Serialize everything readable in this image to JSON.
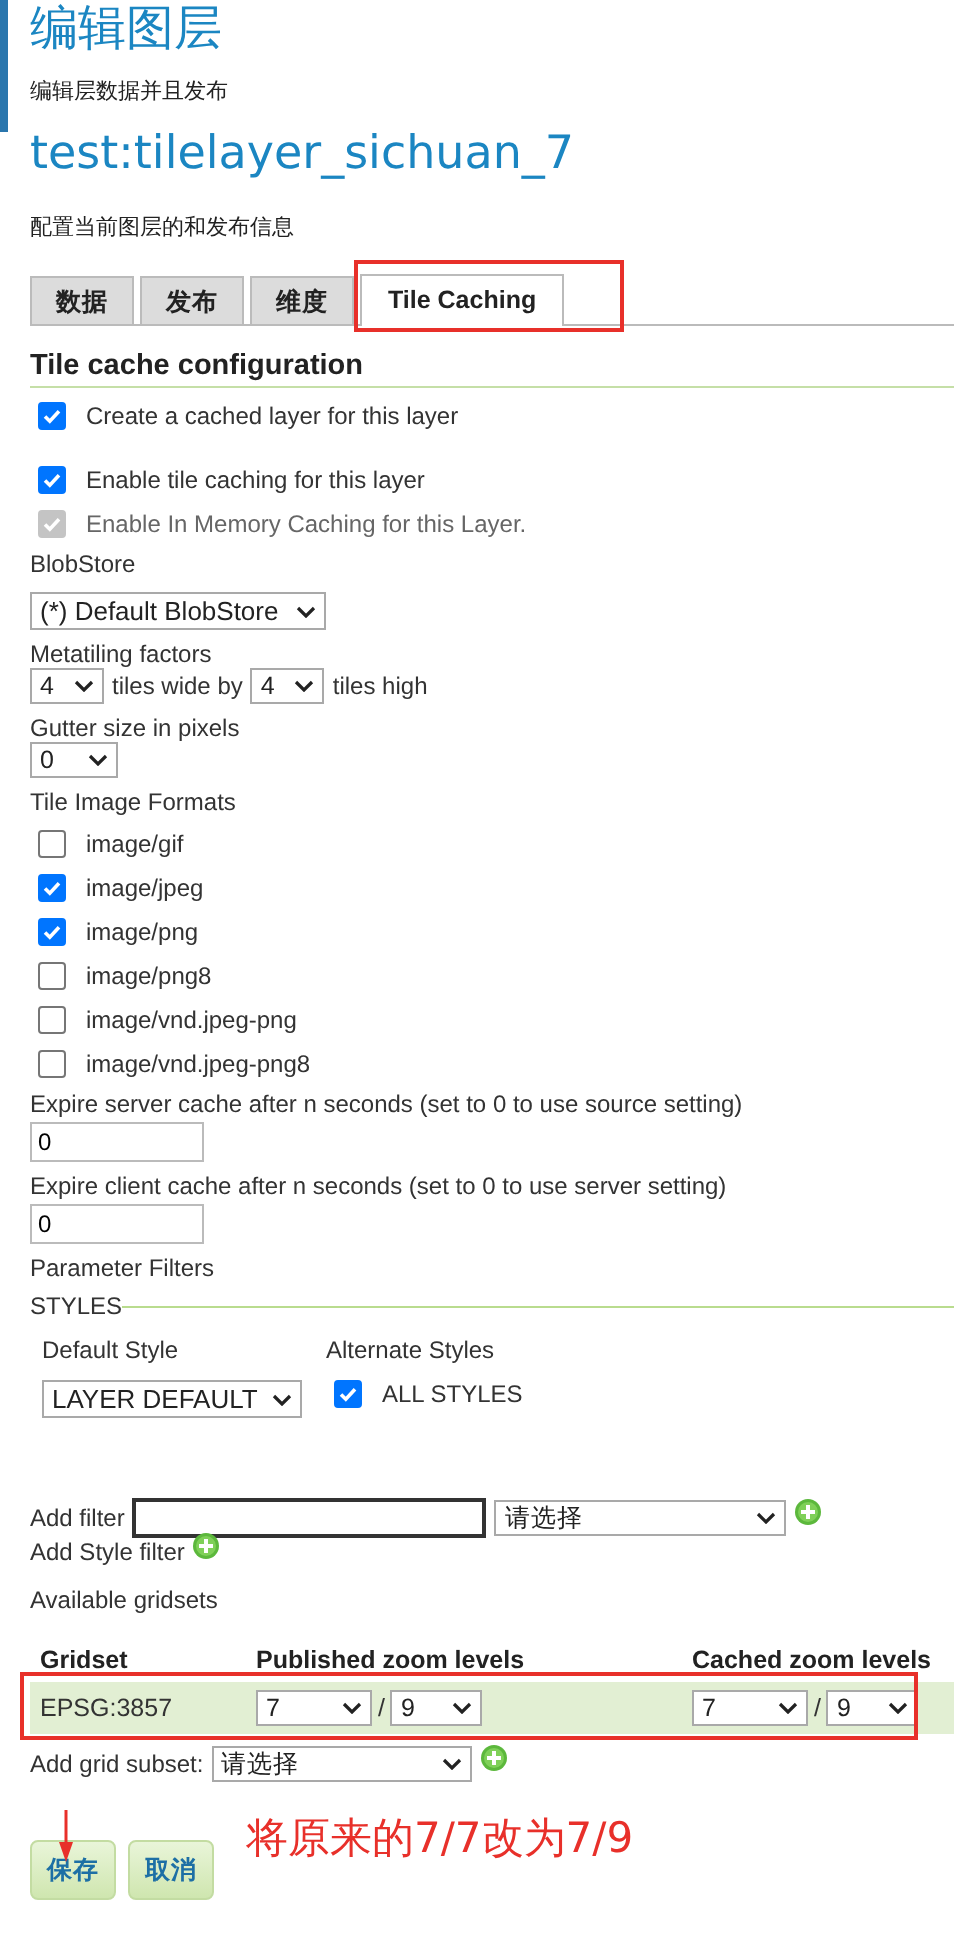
{
  "header": {
    "title": "编辑图层",
    "subtitle": "编辑层数据并且发布",
    "layer_name": "test:tilelayer_sichuan_7",
    "description": "配置当前图层的和发布信息"
  },
  "tabs": [
    {
      "label": "数据",
      "selected": false,
      "highlighted": false
    },
    {
      "label": "发布",
      "selected": false,
      "highlighted": false
    },
    {
      "label": "维度",
      "selected": false,
      "highlighted": false
    },
    {
      "label": "Tile Caching",
      "selected": true,
      "highlighted": true
    }
  ],
  "section_title": "Tile cache configuration",
  "options": [
    {
      "label": "Create a cached layer for this layer",
      "checked": true,
      "disabled": false
    },
    {
      "label": "Enable tile caching for this layer",
      "checked": true,
      "disabled": false
    },
    {
      "label": "Enable In Memory Caching for this Layer.",
      "checked": true,
      "disabled": true
    }
  ],
  "blobstore": {
    "label": "BlobStore",
    "value": "(*) Default BlobStore"
  },
  "metatiling": {
    "label": "Metatiling factors",
    "wide_value": "4",
    "wide_text": "tiles wide by",
    "high_value": "4",
    "high_text": "tiles high"
  },
  "gutter": {
    "label": "Gutter size in pixels",
    "value": "0"
  },
  "formats": {
    "label": "Tile Image Formats",
    "items": [
      {
        "label": "image/gif",
        "checked": false
      },
      {
        "label": "image/jpeg",
        "checked": true
      },
      {
        "label": "image/png",
        "checked": true
      },
      {
        "label": "image/png8",
        "checked": false
      },
      {
        "label": "image/vnd.jpeg-png",
        "checked": false
      },
      {
        "label": "image/vnd.jpeg-png8",
        "checked": false
      }
    ]
  },
  "server_expire": {
    "label": "Expire server cache after n seconds (set to 0 to use source setting)",
    "value": "0"
  },
  "client_expire": {
    "label": "Expire client cache after n seconds (set to 0 to use server setting)",
    "value": "0"
  },
  "parameter_filters_label": "Parameter Filters",
  "styles": {
    "legend": "STYLES",
    "default_label": "Default Style",
    "default_value": "LAYER DEFAULT",
    "alternate_label": "Alternate Styles",
    "all_styles": {
      "label": "ALL STYLES",
      "checked": true
    }
  },
  "add_filter": {
    "label": "Add filter",
    "select_value": "请选择"
  },
  "add_style_filter": {
    "label": "Add Style filter"
  },
  "gridsets": {
    "label": "Available gridsets",
    "columns": [
      "Gridset",
      "Published zoom levels",
      "Cached zoom levels"
    ],
    "rows": [
      {
        "name": "EPSG:3857",
        "highlighted": true,
        "published": {
          "min": "7",
          "separator": "/",
          "max": "9"
        },
        "cached": {
          "min": "7",
          "separator": "/",
          "max": "9"
        }
      }
    ]
  },
  "add_grid_subset": {
    "label": "Add grid subset:",
    "value": "请选择"
  },
  "annotation": "将原来的7/7改为7/9",
  "buttons": [
    {
      "label": "保存",
      "pointed": true
    },
    {
      "label": "取消",
      "pointed": false
    }
  ]
}
